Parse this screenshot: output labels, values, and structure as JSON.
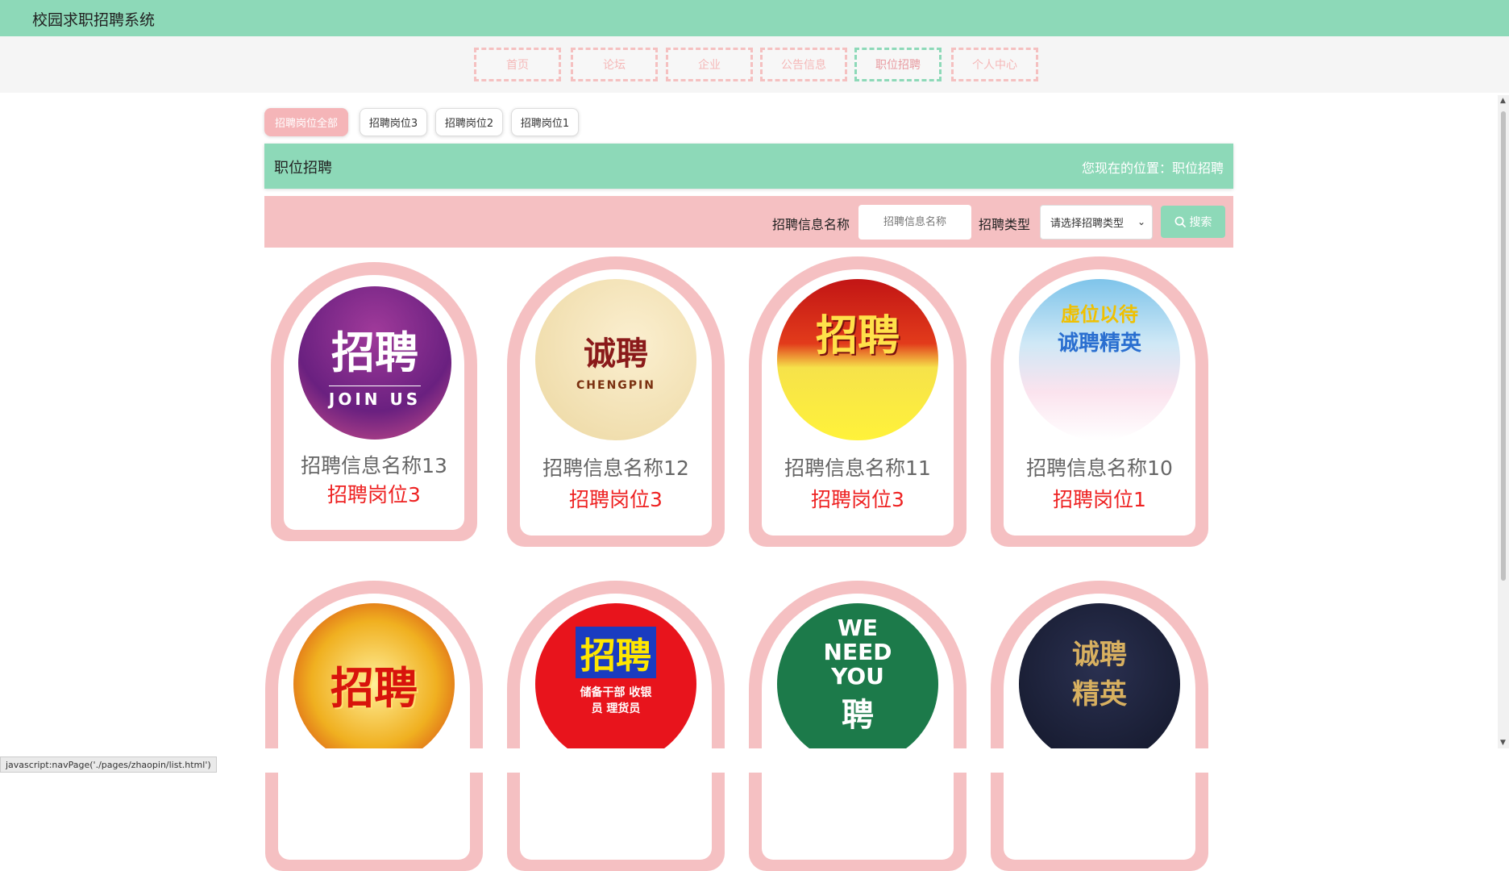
{
  "app": {
    "title": "校园求职招聘系统"
  },
  "nav": [
    "首页",
    "论坛",
    "企业",
    "公告信息",
    "职位招聘",
    "个人中心"
  ],
  "tabs": [
    "招聘岗位全部",
    "招聘岗位3",
    "招聘岗位2",
    "招聘岗位1"
  ],
  "header": {
    "title": "职位招聘",
    "location": "您现在的位置：职位招聘"
  },
  "search": {
    "name_label": "招聘信息名称",
    "name_placeholder": "招聘信息名称",
    "type_label": "招聘类型",
    "type_selected": "请选择招聘类型",
    "button_label": "搜索"
  },
  "cards": [
    {
      "name": "招聘信息名称13",
      "position": "招聘岗位3",
      "img_text": "招聘",
      "img_sub": "JOIN US"
    },
    {
      "name": "招聘信息名称12",
      "position": "招聘岗位3",
      "img_text": "诚聘",
      "img_sub": "CHENGPIN"
    },
    {
      "name": "招聘信息名称11",
      "position": "招聘岗位3",
      "img_text": "招聘",
      "img_sub": ""
    },
    {
      "name": "招聘信息名称10",
      "position": "招聘岗位1",
      "img_text": "虚位以待",
      "img_sub": "诚聘精英"
    },
    {
      "name": "",
      "position": "",
      "img_text": "招聘",
      "img_sub": ""
    },
    {
      "name": "",
      "position": "",
      "img_text": "招聘",
      "img_sub": "储备干部 收银员 理货员"
    },
    {
      "name": "",
      "position": "",
      "img_text": "WE NEED YOU",
      "img_sub": "聘"
    },
    {
      "name": "",
      "position": "",
      "img_text": "诚聘精英",
      "img_sub": ""
    }
  ],
  "status_bar": "javascript:navPage('./pages/zhaopin/list.html')",
  "colors": {
    "primary": "#8dd9b8",
    "pink": "#f5c0c2",
    "red_text": "#ee2222"
  }
}
